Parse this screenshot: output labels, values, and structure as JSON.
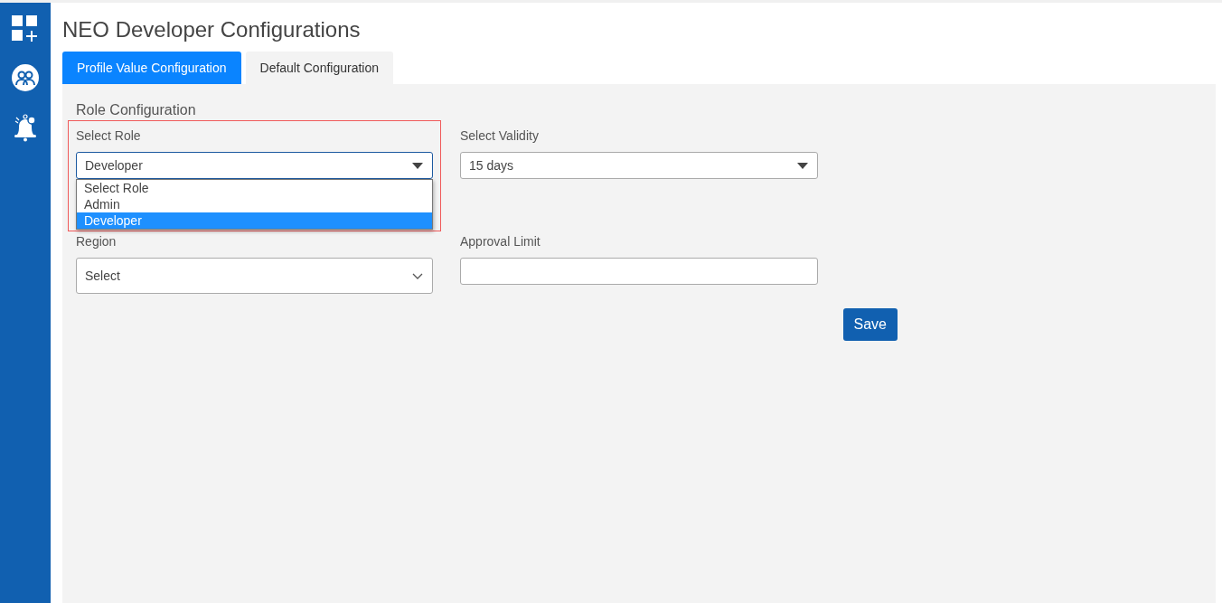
{
  "title": "NEO Developer Configurations",
  "tabs": [
    {
      "label": "Profile Value Configuration",
      "selected": true
    },
    {
      "label": "Default Configuration",
      "selected": false
    }
  ],
  "section": {
    "title": "Role Configuration"
  },
  "role": {
    "label": "Select Role",
    "value": "Developer",
    "highlighted": true,
    "options": [
      {
        "label": "Select Role",
        "selected": false
      },
      {
        "label": "Admin",
        "selected": false
      },
      {
        "label": "Developer",
        "selected": true
      }
    ]
  },
  "validity": {
    "label": "Select Validity",
    "value": "15 days"
  },
  "region": {
    "label": "Region",
    "value": "Select"
  },
  "approval_limit": {
    "label": "Approval Limit"
  },
  "save_button": "Save"
}
